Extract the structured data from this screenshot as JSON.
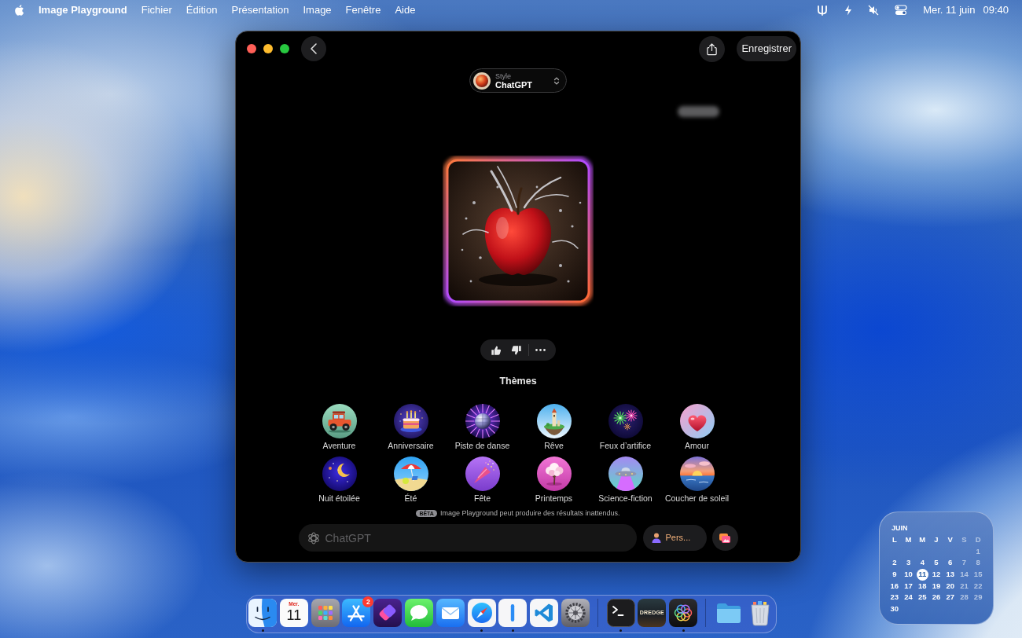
{
  "menu_bar": {
    "app_name": "Image Playground",
    "menus": [
      "Fichier",
      "Édition",
      "Présentation",
      "Image",
      "Fenêtre",
      "Aide"
    ],
    "date": "Mer. 11 juin",
    "time": "09:40"
  },
  "window": {
    "save_button": "Enregistrer",
    "style_picker": {
      "label": "Style",
      "value": "ChatGPT"
    },
    "themes_title": "Thèmes",
    "themes": [
      {
        "kind": "car",
        "label": "Aventure"
      },
      {
        "kind": "cake",
        "label": "Anniversaire"
      },
      {
        "kind": "disco",
        "label": "Piste de danse"
      },
      {
        "kind": "island",
        "label": "Rêve"
      },
      {
        "kind": "fireworks",
        "label": "Feux d’artifice"
      },
      {
        "kind": "heart",
        "label": "Amour"
      },
      {
        "kind": "moon",
        "label": "Nuit étoilée"
      },
      {
        "kind": "beach",
        "label": "Été"
      },
      {
        "kind": "party",
        "label": "Fête"
      },
      {
        "kind": "tree",
        "label": "Printemps"
      },
      {
        "kind": "ufo",
        "label": "Science-fiction"
      },
      {
        "kind": "sunset",
        "label": "Coucher de soleil"
      }
    ],
    "beta_badge": "BÊTA",
    "beta_notice": "Image Playground peut produire des résultats inattendus.",
    "prompt": {
      "placeholder": "ChatGPT"
    },
    "person_button": "Pers..."
  },
  "calendar_widget": {
    "month": "JUIN",
    "weekdays": [
      {
        "label": "L",
        "dimmed": false
      },
      {
        "label": "M",
        "dimmed": false
      },
      {
        "label": "M",
        "dimmed": false
      },
      {
        "label": "J",
        "dimmed": false
      },
      {
        "label": "V",
        "dimmed": false
      },
      {
        "label": "S",
        "dimmed": true
      },
      {
        "label": "D",
        "dimmed": true
      }
    ],
    "weeks": [
      [
        {
          "label": "1",
          "dimmed": true,
          "selected": false
        }
      ],
      [
        {
          "label": "2",
          "dimmed": false,
          "selected": false
        },
        {
          "label": "3",
          "dimmed": false,
          "selected": false
        },
        {
          "label": "4",
          "dimmed": false,
          "selected": false
        },
        {
          "label": "5",
          "dimmed": false,
          "selected": false
        },
        {
          "label": "6",
          "dimmed": false,
          "selected": false
        },
        {
          "label": "7",
          "dimmed": true,
          "selected": false
        },
        {
          "label": "8",
          "dimmed": true,
          "selected": false
        }
      ],
      [
        {
          "label": "9",
          "dimmed": false,
          "selected": false
        },
        {
          "label": "10",
          "dimmed": false,
          "selected": false
        },
        {
          "label": "11",
          "dimmed": false,
          "selected": true
        },
        {
          "label": "12",
          "dimmed": false,
          "selected": false
        },
        {
          "label": "13",
          "dimmed": false,
          "selected": false
        },
        {
          "label": "14",
          "dimmed": true,
          "selected": false
        },
        {
          "label": "15",
          "dimmed": true,
          "selected": false
        }
      ],
      [
        {
          "label": "16",
          "dimmed": false,
          "selected": false
        },
        {
          "label": "17",
          "dimmed": false,
          "selected": false
        },
        {
          "label": "18",
          "dimmed": false,
          "selected": false
        },
        {
          "label": "19",
          "dimmed": false,
          "selected": false
        },
        {
          "label": "20",
          "dimmed": false,
          "selected": false
        },
        {
          "label": "21",
          "dimmed": true,
          "selected": false
        },
        {
          "label": "22",
          "dimmed": true,
          "selected": false
        }
      ],
      [
        {
          "label": "23",
          "dimmed": false,
          "selected": false
        },
        {
          "label": "24",
          "dimmed": false,
          "selected": false
        },
        {
          "label": "25",
          "dimmed": false,
          "selected": false
        },
        {
          "label": "26",
          "dimmed": false,
          "selected": false
        },
        {
          "label": "27",
          "dimmed": false,
          "selected": false
        },
        {
          "label": "28",
          "dimmed": true,
          "selected": false
        },
        {
          "label": "29",
          "dimmed": true,
          "selected": false
        }
      ],
      [
        {
          "label": "30",
          "dimmed": false,
          "selected": false
        }
      ]
    ]
  },
  "dock": {
    "sections": [
      {
        "items": [
          {
            "kind": "finder",
            "running": true
          },
          {
            "kind": "calendar",
            "day_name": "Mer.",
            "day": "11",
            "running": false
          },
          {
            "kind": "launchpad",
            "running": false
          },
          {
            "kind": "app-store",
            "badge": "2",
            "running": false
          },
          {
            "kind": "shortcuts",
            "running": false
          },
          {
            "kind": "messages",
            "running": false
          },
          {
            "kind": "mail",
            "running": false
          },
          {
            "kind": "safari",
            "running": true
          },
          {
            "kind": "bar-app",
            "running": true
          },
          {
            "kind": "code-editor",
            "running": false
          },
          {
            "kind": "settings",
            "running": false
          }
        ]
      },
      {
        "items": [
          {
            "kind": "terminal",
            "running": true
          },
          {
            "kind": "game",
            "label": "DREDGE",
            "running": false
          },
          {
            "kind": "playground",
            "running": true
          }
        ]
      },
      {
        "items": [
          {
            "kind": "folder",
            "running": false
          },
          {
            "kind": "trash",
            "running": false
          }
        ]
      }
    ]
  }
}
